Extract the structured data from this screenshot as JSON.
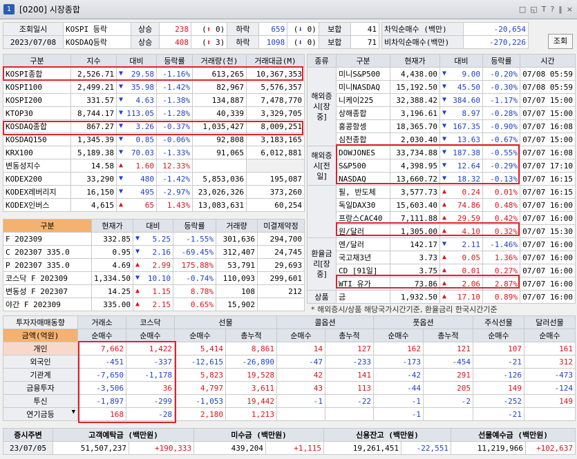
{
  "window": {
    "num": "1",
    "title": "[0200] 시장종합",
    "icons": [
      "□",
      "◱",
      "T",
      "?",
      "‖",
      "×"
    ]
  },
  "top": {
    "label": "조회일시",
    "date": "2023/07/08",
    "rows": [
      {
        "name": "KOSPI 등락",
        "up_label": "상승",
        "up": "238",
        "arrow_up": "0",
        "down_label": "하락",
        "down": "659",
        "arrow_dn": "0",
        "flat_label": "보합",
        "flat": "41"
      },
      {
        "name": "KOSDAQ등락",
        "up_label": "상승",
        "up": "408",
        "arrow_up": "3",
        "down_label": "하락",
        "down": "1098",
        "arrow_dn": "0",
        "flat_label": "보합",
        "flat": "71"
      }
    ],
    "arb": [
      {
        "label": "차익순매수  (백만)",
        "value": "-20,654"
      },
      {
        "label": "비차익순매수(백만)",
        "value": "-270,226"
      }
    ],
    "search": "조회"
  },
  "left": {
    "headers": [
      "구분",
      "지수",
      "대비",
      "등락률",
      "거래량(천)",
      "거래대금(M)"
    ],
    "rows": [
      [
        "KOSPI종합",
        "2,526.71",
        "dn",
        "29.58",
        "-1.16%",
        "613,265",
        "10,367,353"
      ],
      [
        "KOSPI100",
        "2,499.21",
        "dn",
        "35.98",
        "-1.42%",
        "82,967",
        "5,576,357"
      ],
      [
        "KOSPI200",
        "331.57",
        "dn",
        "4.63",
        "-1.38%",
        "134,887",
        "7,478,770"
      ],
      [
        "KTOP30",
        "8,744.17",
        "dn",
        "113.05",
        "-1.28%",
        "40,339",
        "3,329,705"
      ],
      [
        "KOSDAQ종합",
        "867.27",
        "dn",
        "3.26",
        "-0.37%",
        "1,035,427",
        "8,009,251"
      ],
      [
        "KOSDAQ150",
        "1,345.39",
        "dn",
        "0.85",
        "-0.06%",
        "92,808",
        "3,183,165"
      ],
      [
        "KRX100",
        "5,189.38",
        "dn",
        "70.03",
        "-1.33%",
        "91,065",
        "6,012,881"
      ],
      [
        "변동성지수",
        "14.58",
        "up",
        "1.60",
        "12.33%",
        "",
        ""
      ],
      [
        "KODEX200",
        "33,290",
        "dn",
        "480",
        "-1.42%",
        "5,853,036",
        "195,087"
      ],
      [
        "KODEX레버리지",
        "16,150",
        "dn",
        "495",
        "-2.97%",
        "23,026,326",
        "373,260"
      ],
      [
        "KODEX인버스",
        "4,615",
        "up",
        "65",
        "1.43%",
        "13,083,631",
        "60,254"
      ]
    ],
    "fut_headers": [
      "구분",
      "현재가",
      "대비",
      "등락률",
      "거래량",
      "미결제약정"
    ],
    "fut": [
      [
        "F 202309",
        "332.85",
        "dn",
        "5.25",
        "-1.55%",
        "301,636",
        "294,700"
      ],
      [
        "C 202307 335.0",
        "0.95",
        "dn",
        "2.16",
        "-69.45%",
        "312,407",
        "24,745"
      ],
      [
        "P 202307 335.0",
        "4.69",
        "up",
        "2.99",
        "175.88%",
        "53,791",
        "29,693"
      ],
      [
        "코스닥 F 202309",
        "1,334.50",
        "dn",
        "10.10",
        "-0.74%",
        "110,093",
        "299,601"
      ],
      [
        "변동성 F 202307",
        "14.25",
        "up",
        "1.15",
        "8.78%",
        "108",
        "212"
      ],
      [
        "야간 F 202309",
        "335.00",
        "up",
        "2.15",
        "0.65%",
        "15,902",
        ""
      ]
    ]
  },
  "right": {
    "headers": [
      "종류",
      "구분",
      "현재가",
      "대비",
      "등락률",
      "시간"
    ],
    "groups": [
      {
        "name": "해외증시[장중]",
        "rows": 6
      },
      {
        "name": "해외증시[전일]",
        "rows": 3
      },
      {
        "name": "",
        "rows": 4
      },
      {
        "name": "환율금리[장중]",
        "rows": 4
      },
      {
        "name": "상품",
        "rows": 2
      }
    ],
    "rows": [
      [
        "미니S&P500",
        "4,438.00",
        "dn",
        "9.00",
        "-0.20%",
        "07/08 05:59"
      ],
      [
        "미니NASDAQ",
        "15,192.50",
        "dn",
        "45.50",
        "-0.30%",
        "07/08 05:59"
      ],
      [
        "니케이225",
        "32,388.42",
        "dn",
        "384.60",
        "-1.17%",
        "07/07 15:00"
      ],
      [
        "상해종합",
        "3,196.61",
        "dn",
        "8.97",
        "-0.28%",
        "07/07 15:00"
      ],
      [
        "홍콩항셍",
        "18,365.70",
        "dn",
        "167.35",
        "-0.90%",
        "07/07 16:08"
      ],
      [
        "심천종합",
        "2,030.40",
        "dn",
        "13.63",
        "-0.67%",
        "07/07 15:00"
      ],
      [
        "DOWJONES",
        "33,734.88",
        "dn",
        "187.38",
        "-0.55%",
        "07/07 16:08"
      ],
      [
        "S&P500",
        "4,398.95",
        "dn",
        "12.64",
        "-0.29%",
        "07/07 17:10"
      ],
      [
        "NASDAQ",
        "13,660.72",
        "dn",
        "18.32",
        "-0.13%",
        "07/07 16:15"
      ],
      [
        "필, 반도체",
        "3,577.73",
        "up",
        "0.24",
        "0.01%",
        "07/07 16:15"
      ],
      [
        "독일DAX30",
        "15,603.40",
        "up",
        "74.86",
        "0.48%",
        "07/07 16:00"
      ],
      [
        "프랑스CAC40",
        "7,111.88",
        "up",
        "29.59",
        "0.42%",
        "07/07 16:00"
      ],
      [
        "원/달러",
        "1,305.00",
        "up",
        "4.10",
        "0.32%",
        "07/07 15:30"
      ],
      [
        "엔/달러",
        "142.17",
        "dn",
        "2.11",
        "-1.46%",
        "07/07 16:00"
      ],
      [
        "국고채3년",
        "3.73",
        "up",
        "0.05",
        "1.36%",
        "07/07 16:00"
      ],
      [
        "CD [91일]",
        "3.75",
        "up",
        "0.01",
        "0.27%",
        "07/07 16:00"
      ],
      [
        "WTI 유가",
        "73.86",
        "up",
        "2.06",
        "2.87%",
        "07/07 16:00"
      ],
      [
        "금",
        "1,932.50",
        "up",
        "17.10",
        "0.89%",
        "07/07 16:00"
      ]
    ],
    "note": "* 해외증시/상품 해당국가시간기준, 환율금리 한국시간기준"
  },
  "investor": {
    "title": "투자자매매동향",
    "unit": "금액(억원)",
    "cols": [
      "거래소",
      "코스닥",
      "선물",
      "콜옵션",
      "풋옵션",
      "주식선물",
      "달러선물"
    ],
    "sub": [
      "순매수",
      "순매수",
      "순매수",
      "총누적",
      "순매수",
      "총누적",
      "순매수",
      "총누적",
      "순매수",
      "순매수"
    ],
    "rows": [
      [
        "개인",
        "7,662",
        "1,422",
        "5,414",
        "8,861",
        "14",
        "127",
        "162",
        "121",
        "107",
        "161"
      ],
      [
        "외국인",
        "-451",
        "-337",
        "-12,615",
        "-26,890",
        "-47",
        "-233",
        "-173",
        "-454",
        "-21",
        "312"
      ],
      [
        "기관계",
        "-7,650",
        "-1,178",
        "5,823",
        "19,528",
        "42",
        "141",
        "-42",
        "291",
        "-126",
        "-473"
      ],
      [
        "금융투자",
        "-3,506",
        "36",
        "4,797",
        "3,611",
        "43",
        "113",
        "-44",
        "205",
        "149",
        "-124"
      ],
      [
        "투신",
        "-1,897",
        "-299",
        "-1,053",
        "19,442",
        "-1",
        "-22",
        "-1",
        "-2",
        "-252",
        "149"
      ],
      [
        "연기금등",
        "168",
        "-28",
        "2,180",
        "1,213",
        "",
        "",
        "-1",
        "",
        "-21",
        ""
      ]
    ]
  },
  "bottom": {
    "headers": [
      "증시주변",
      "고객예탁금 (백만원)",
      "미수금 (백만원)",
      "신용잔고 (백만원)",
      "선물예수금 (백만원)"
    ],
    "row": [
      "23/07/05",
      "51,507,237",
      "+190,333",
      "439,204",
      "+1,115",
      "19,261,451",
      "-22,551",
      "11,219,966",
      "+102,637"
    ]
  }
}
